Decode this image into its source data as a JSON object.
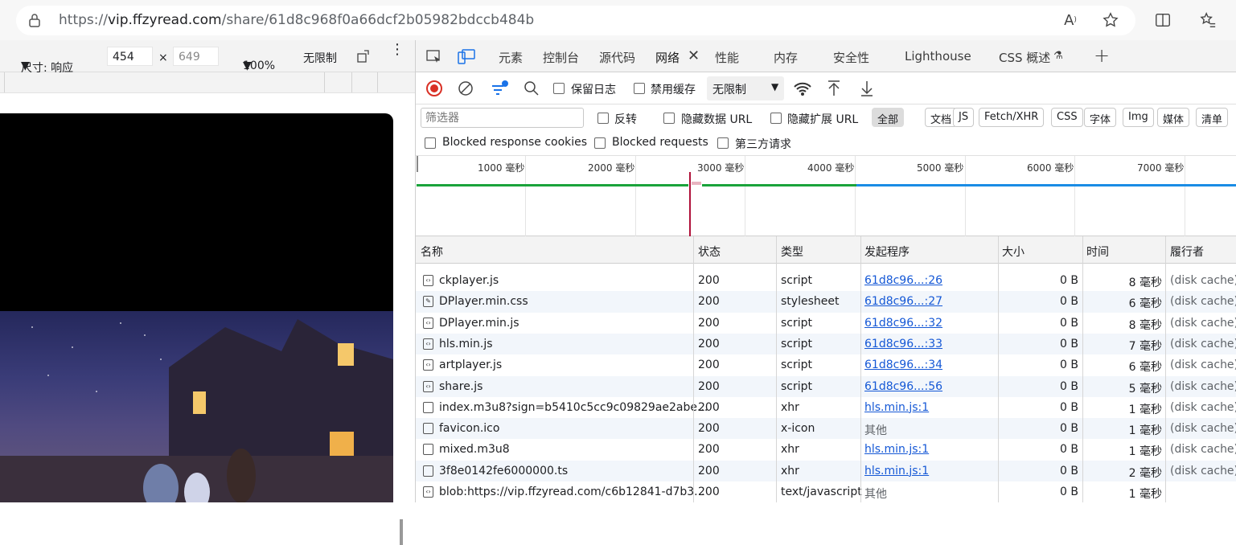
{
  "browser": {
    "url_prefix": "https://",
    "url_host": "vip.ffzyread.com",
    "url_path": "/share/61d8c968f0a66dcf2b05982bdccb484b",
    "icons": [
      "lock-icon",
      "read-aloud-icon",
      "favorite-icon",
      "split-screen-icon",
      "favorites-list-icon"
    ]
  },
  "device_toolbar": {
    "dimensions_label": "尺寸: 响应",
    "width": "454",
    "height": "649",
    "zoom": "100%",
    "throttle": "无限制"
  },
  "devtools": {
    "tabs": [
      "元素",
      "控制台",
      "源代码",
      "网络",
      "性能",
      "内存",
      "安全性",
      "Lighthouse",
      "CSS 概述"
    ],
    "active_tab": "网络",
    "toolbar": {
      "preserve_log": "保留日志",
      "disable_cache": "禁用缓存",
      "throttle": "无限制"
    },
    "filter": {
      "placeholder": "筛选器",
      "invert": "反转",
      "hide_data_urls": "隐藏数据 URL",
      "hide_ext_urls": "隐藏扩展 URL",
      "types": [
        "全部",
        "文档",
        "JS",
        "Fetch/XHR",
        "CSS",
        "字体",
        "Img",
        "媒体",
        "清单"
      ],
      "blocked_cookies": "Blocked response cookies",
      "blocked_requests": "Blocked requests",
      "third_party": "第三方请求"
    },
    "overview_ticks": [
      "1000  毫秒",
      "2000  毫秒",
      "3000  毫秒",
      "4000  毫秒",
      "5000  毫秒",
      "6000  毫秒",
      "7000  毫秒"
    ],
    "columns": [
      "名称",
      "状态",
      "类型",
      "发起程序",
      "大小",
      "时间",
      "履行者"
    ],
    "rows": [
      {
        "name": "ckplayer.js",
        "status": "200",
        "type": "script",
        "initiator": "61d8c96...:26",
        "size": "0 B",
        "time": "8 毫秒",
        "fulfilled": "(disk cache)",
        "icon": "script"
      },
      {
        "name": "DPlayer.min.css",
        "status": "200",
        "type": "stylesheet",
        "initiator": "61d8c96...:27",
        "size": "0 B",
        "time": "6 毫秒",
        "fulfilled": "(disk cache)",
        "icon": "css"
      },
      {
        "name": "DPlayer.min.js",
        "status": "200",
        "type": "script",
        "initiator": "61d8c96...:32",
        "size": "0 B",
        "time": "8 毫秒",
        "fulfilled": "(disk cache)",
        "icon": "script"
      },
      {
        "name": "hls.min.js",
        "status": "200",
        "type": "script",
        "initiator": "61d8c96...:33",
        "size": "0 B",
        "time": "7 毫秒",
        "fulfilled": "(disk cache)",
        "icon": "script"
      },
      {
        "name": "artplayer.js",
        "status": "200",
        "type": "script",
        "initiator": "61d8c96...:34",
        "size": "0 B",
        "time": "6 毫秒",
        "fulfilled": "(disk cache)",
        "icon": "script"
      },
      {
        "name": "share.js",
        "status": "200",
        "type": "script",
        "initiator": "61d8c96...:56",
        "size": "0 B",
        "time": "5 毫秒",
        "fulfilled": "(disk cache)",
        "icon": "script"
      },
      {
        "name": "index.m3u8?sign=b5410c5cc9c09829ae2abe...",
        "status": "200",
        "type": "xhr",
        "initiator": "hls.min.js:1",
        "size": "0 B",
        "time": "1 毫秒",
        "fulfilled": "(disk cache)",
        "icon": "doc"
      },
      {
        "name": "favicon.ico",
        "status": "200",
        "type": "x-icon",
        "initiator": "其他",
        "size": "0 B",
        "time": "1 毫秒",
        "fulfilled": "(disk cache)",
        "icon": "file"
      },
      {
        "name": "mixed.m3u8",
        "status": "200",
        "type": "xhr",
        "initiator": "hls.min.js:1",
        "size": "0 B",
        "time": "1 毫秒",
        "fulfilled": "(disk cache)",
        "icon": "doc"
      },
      {
        "name": "3f8e0142fe6000000.ts",
        "status": "200",
        "type": "xhr",
        "initiator": "hls.min.js:1",
        "size": "0 B",
        "time": "2 毫秒",
        "fulfilled": "(disk cache)",
        "icon": "doc"
      },
      {
        "name": "blob:https://vip.ffzyread.com/c6b12841-d7b3...",
        "status": "200",
        "type": "text/javascript",
        "initiator": "其他",
        "size": "0 B",
        "time": "1 毫秒",
        "fulfilled": "",
        "icon": "script"
      }
    ]
  },
  "colors": {
    "accent": "#1558d6",
    "record": "#d93025",
    "green": "#1aa33a",
    "blue": "#1a8ce5"
  }
}
